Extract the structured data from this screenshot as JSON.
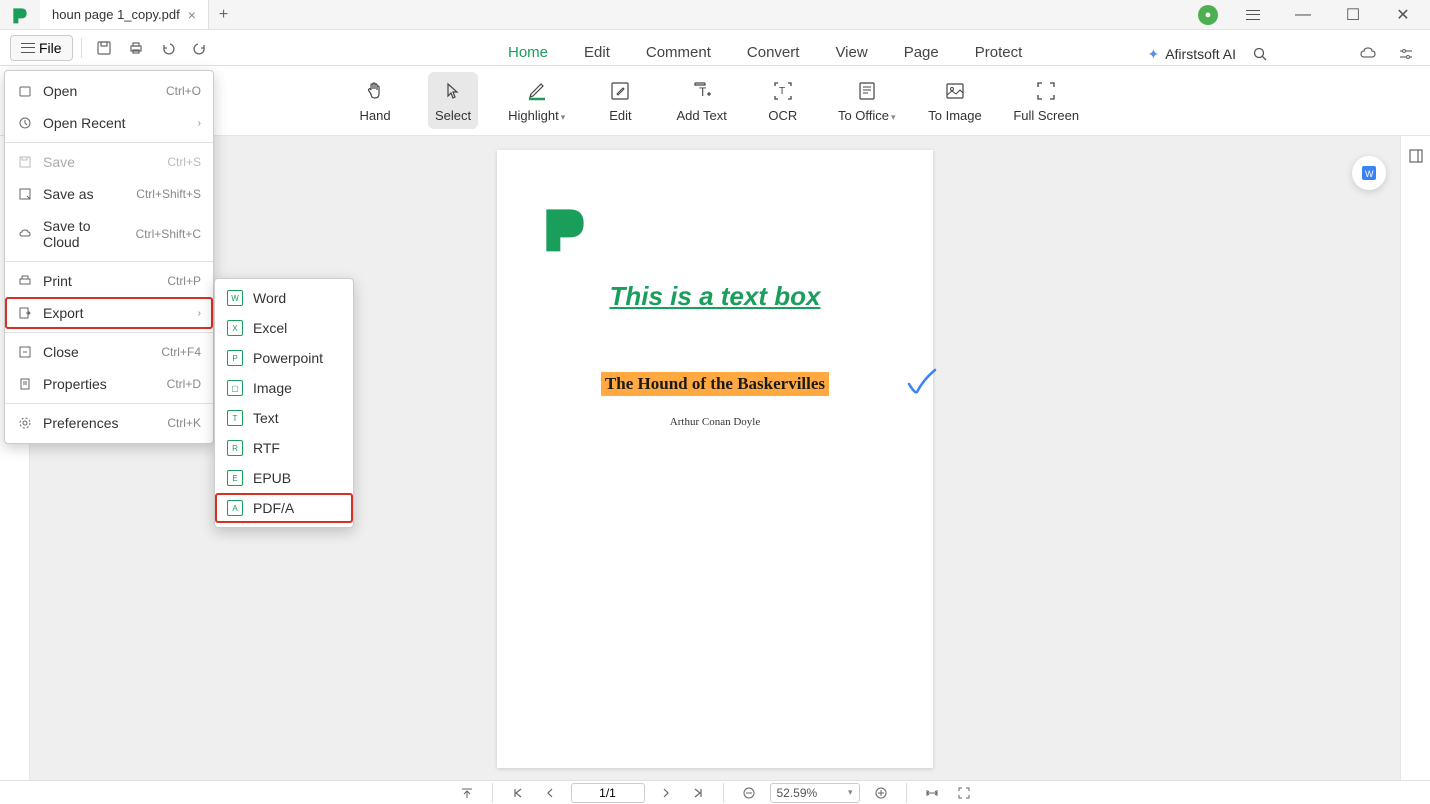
{
  "titlebar": {
    "tab_name": "houn page 1_copy.pdf"
  },
  "toolbar": {
    "file_label": "File"
  },
  "menu_tabs": {
    "home": "Home",
    "edit": "Edit",
    "comment": "Comment",
    "convert": "Convert",
    "view": "View",
    "page": "Page",
    "protect": "Protect"
  },
  "ai": {
    "label": "Afirstsoft AI"
  },
  "ribbon": {
    "hand": "Hand",
    "select": "Select",
    "highlight": "Highlight",
    "edit": "Edit",
    "add_text": "Add Text",
    "ocr": "OCR",
    "to_office": "To Office",
    "to_image": "To Image",
    "full_screen": "Full Screen"
  },
  "file_menu": {
    "open": {
      "label": "Open",
      "shortcut": "Ctrl+O"
    },
    "open_recent": {
      "label": "Open Recent"
    },
    "save": {
      "label": "Save",
      "shortcut": "Ctrl+S"
    },
    "save_as": {
      "label": "Save as",
      "shortcut": "Ctrl+Shift+S"
    },
    "save_cloud": {
      "label": "Save to Cloud",
      "shortcut": "Ctrl+Shift+C"
    },
    "print": {
      "label": "Print",
      "shortcut": "Ctrl+P"
    },
    "export": {
      "label": "Export"
    },
    "close": {
      "label": "Close",
      "shortcut": "Ctrl+F4"
    },
    "properties": {
      "label": "Properties",
      "shortcut": "Ctrl+D"
    },
    "preferences": {
      "label": "Preferences",
      "shortcut": "Ctrl+K"
    }
  },
  "export_submenu": {
    "word": "Word",
    "excel": "Excel",
    "powerpoint": "Powerpoint",
    "image": "Image",
    "text": "Text",
    "rtf": "RTF",
    "epub": "EPUB",
    "pdfa": "PDF/A"
  },
  "document": {
    "textbox": "This is a text box",
    "title": "The Hound of the Baskervilles",
    "author": "Arthur Conan Doyle"
  },
  "status": {
    "page": "1/1",
    "zoom": "52.59%"
  }
}
